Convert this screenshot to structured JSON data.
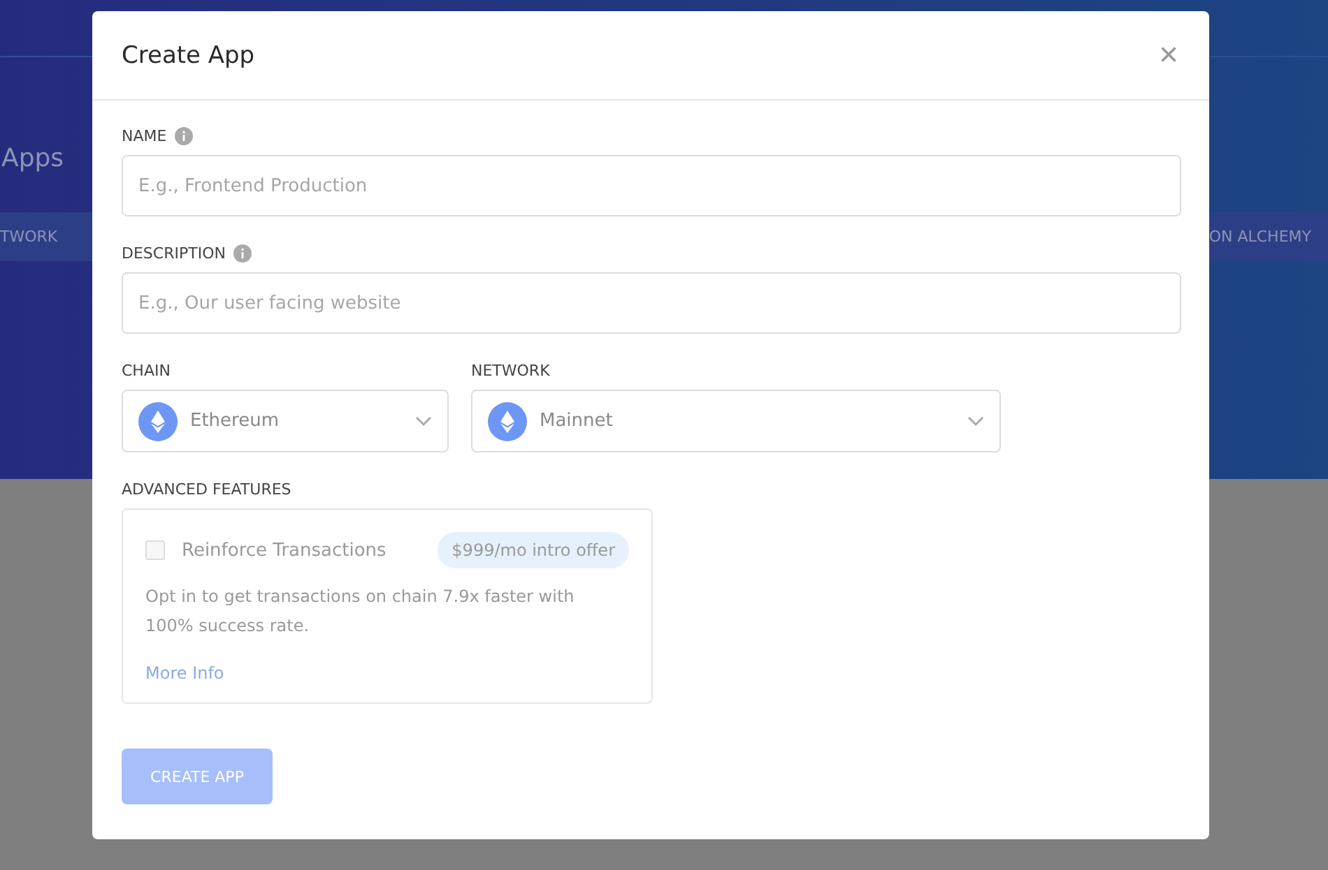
{
  "background": {
    "title": "Apps",
    "band_left": "TWORK",
    "band_right": "ON ALCHEMY"
  },
  "modal": {
    "title": "Create App",
    "close": "×",
    "fields": [
      {
        "label": "NAME",
        "placeholder": "E.g., Frontend Production"
      },
      {
        "label": "DESCRIPTION",
        "placeholder": "E.g., Our user facing website"
      }
    ],
    "selects": [
      {
        "label": "CHAIN",
        "value": "Ethereum"
      },
      {
        "label": "NETWORK",
        "value": "Mainnet"
      }
    ],
    "advanced": {
      "label": "ADVANCED FEATURES",
      "option": "Reinforce Transactions",
      "checked": false,
      "badge": "$999/mo intro offer",
      "description": "Opt in to get transactions on chain 7.9x faster with 100% success rate.",
      "link": "More Info"
    },
    "submit": {
      "label": "CREATE APP",
      "disabled": true
    }
  }
}
